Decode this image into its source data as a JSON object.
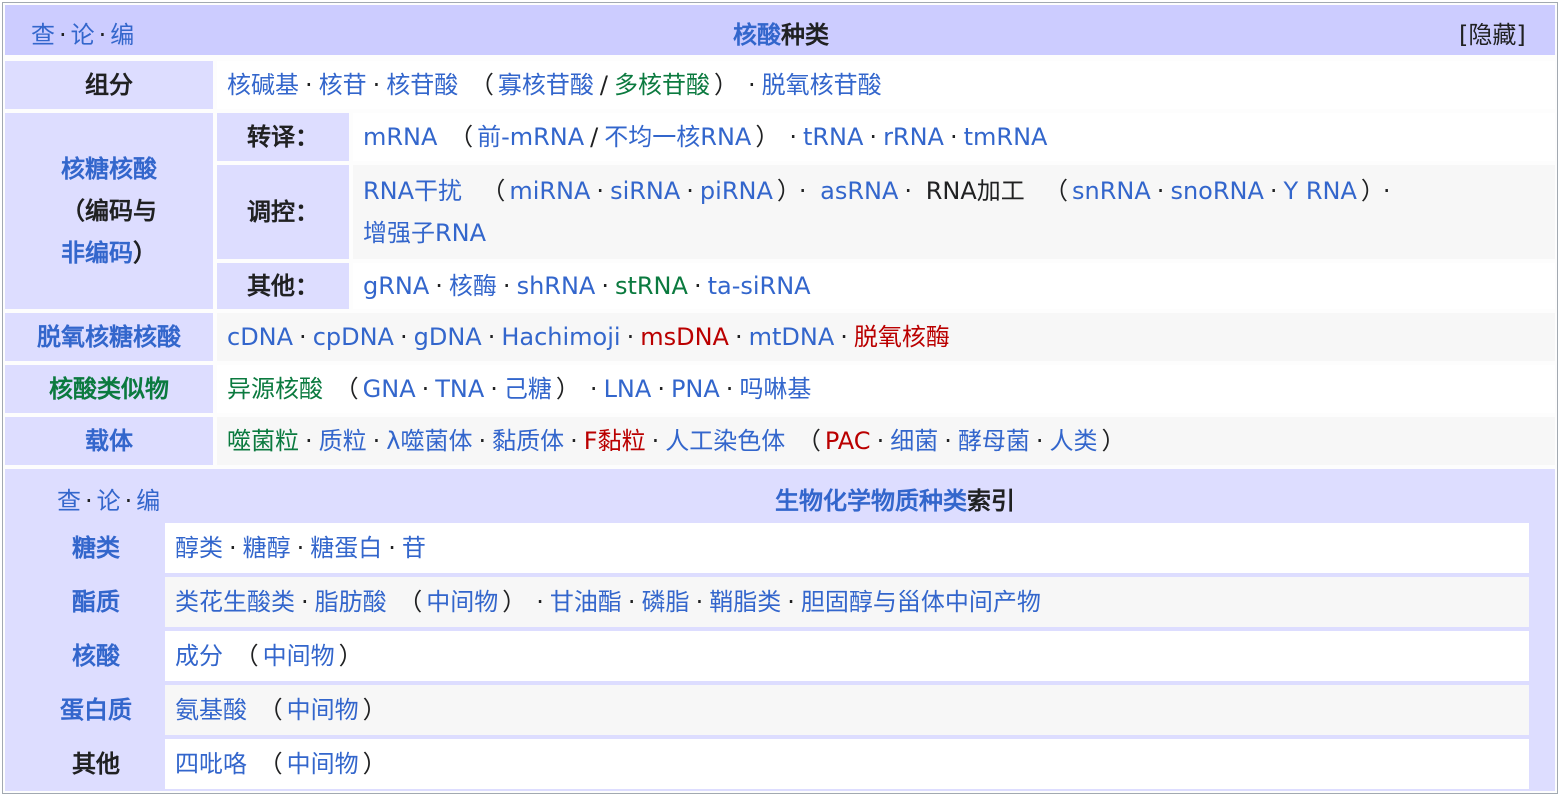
{
  "navbox1": {
    "vte": [
      "查",
      "论",
      "编"
    ],
    "title_link": "核酸",
    "title_rest": "种类",
    "hide": "[隐藏]",
    "rows": {
      "components": {
        "label": "组分",
        "items": [
          "核碱基",
          "核苷",
          "核苷酸",
          "寡核苷酸",
          "多核苷酸",
          "脱氧核苷酸"
        ]
      },
      "rna": {
        "label_line1": "核糖核酸",
        "label_line2": "（编码与",
        "label_line3": "非编码",
        "label_line3_close": "）",
        "sub": {
          "transcription": {
            "label": "转译：",
            "items": [
              "mRNA",
              "前-mRNA",
              "不均一核RNA",
              "tRNA",
              "rRNA",
              "tmRNA"
            ]
          },
          "regulation": {
            "label": "调控：",
            "items": [
              "RNA干扰",
              "miRNA",
              "siRNA",
              "piRNA",
              "asRNA",
              "RNA加工",
              "snRNA",
              "snoRNA",
              "Y RNA",
              "增强子RNA"
            ]
          },
          "other": {
            "label": "其他：",
            "items": [
              "gRNA",
              "核酶",
              "shRNA",
              "stRNA",
              "ta-siRNA"
            ]
          }
        }
      },
      "dna": {
        "label": "脱氧核糖核酸",
        "items": [
          "cDNA",
          "cpDNA",
          "gDNA",
          "Hachimoji",
          "msDNA",
          "mtDNA",
          "脱氧核酶"
        ]
      },
      "analogues": {
        "label": "核酸类似物",
        "items": [
          "异源核酸",
          "GNA",
          "TNA",
          "己糖",
          "LNA",
          "PNA",
          "吗啉基"
        ]
      },
      "vectors": {
        "label": "载体",
        "items": [
          "噬菌粒",
          "质粒",
          "λ噬菌体",
          "黏质体",
          "F黏粒",
          "人工染色体",
          "PAC",
          "细菌",
          "酵母菌",
          "人类"
        ]
      }
    }
  },
  "navbox2": {
    "vte": [
      "查",
      "论",
      "编"
    ],
    "title_link": "生物化学物质种类",
    "title_rest": "索引",
    "rows": {
      "carbs": {
        "label": "糖类",
        "items": [
          "醇类",
          "糖醇",
          "糖蛋白",
          "苷"
        ]
      },
      "lipids": {
        "label": "酯质",
        "items": [
          "类花生酸类",
          "脂肪酸",
          "中间物",
          "甘油酯",
          "磷脂",
          "鞘脂类",
          "胆固醇与甾体中间产物"
        ]
      },
      "nucleic": {
        "label": "核酸",
        "items": [
          "成分",
          "中间物"
        ]
      },
      "proteins": {
        "label": "蛋白质",
        "items": [
          "氨基酸",
          "中间物"
        ]
      },
      "other": {
        "label": "其他",
        "items": [
          "四吡咯",
          "中间物"
        ]
      }
    }
  },
  "colors": {
    "header_bg": "#ccccff",
    "group_bg": "#ddddff",
    "link": "#3366cc",
    "visited_green": "#0b7a3f",
    "redlink": "#ba0000"
  }
}
